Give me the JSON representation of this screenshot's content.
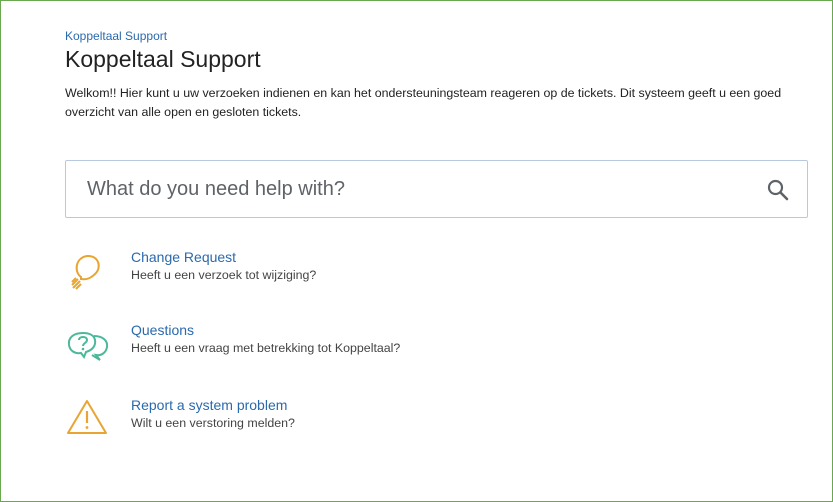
{
  "header": {
    "breadcrumb": "Koppeltaal Support",
    "title": "Koppeltaal Support",
    "intro": "Welkom!! Hier kunt u uw verzoeken indienen en kan het ondersteuningsteam reageren op de tickets. Dit systeem geeft u een goed overzicht van alle open en gesloten tickets."
  },
  "search": {
    "placeholder": "What do you need help with?",
    "icon": "search-icon"
  },
  "request_types": [
    {
      "title": "Change Request",
      "description": "Heeft u een verzoek tot wijziging?",
      "icon": "lightbulb-icon",
      "color": "#e8a531"
    },
    {
      "title": "Questions",
      "description": "Heeft u een vraag met betrekking tot Koppeltaal?",
      "icon": "question-bubbles-icon",
      "color": "#4bb89a"
    },
    {
      "title": "Report a system problem",
      "description": "Wilt u een verstoring melden?",
      "icon": "warning-triangle-icon",
      "color": "#e8a531"
    }
  ],
  "colors": {
    "frame_border": "#6aa84f",
    "link": "#2a6aad",
    "search_border": "#b9c9dd"
  }
}
